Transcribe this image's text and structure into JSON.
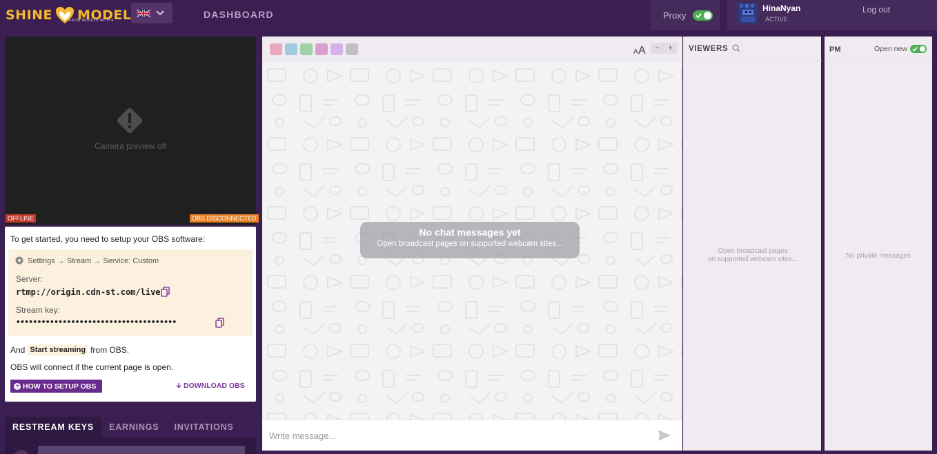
{
  "header": {
    "logo_left": "SHINE",
    "logo_right": "MODEL",
    "logo_tagline": "FROM MODELS WITH ♥",
    "language_icon": "uk-flag-icon",
    "dashboard_label": "DASHBOARD",
    "proxy": {
      "label": "Proxy",
      "enabled": true
    },
    "user": {
      "name": "HinaNyan",
      "status": "ACTIVE"
    },
    "logout_label": "Log out"
  },
  "camera": {
    "icon": "warning-icon",
    "message": "Camera preview off",
    "status_badge": "OFFLINE",
    "obs_badge": "OBS DISCONNECTED"
  },
  "setup": {
    "intro": "To get started, you need to setup your OBS software:",
    "settings_path": "Settings → Stream → Service: Custom",
    "server_label": "Server:",
    "server_value": "rtmp://origin.cdn-st.com/live",
    "stream_key_label": "Stream key:",
    "stream_key_value": "••••••••••••••••••••••••••••••••••••••",
    "and_text": "And",
    "start_streaming": "Start streaming",
    "from_obs": "from OBS.",
    "connect_note": "OBS will connect if the current page is open.",
    "howto_button": "HOW TO SETUP OBS",
    "download_link": "DOWNLOAD OBS"
  },
  "tabs": [
    {
      "label": "RESTREAM KEYS",
      "active": true
    },
    {
      "label": "EARNINGS",
      "active": false
    },
    {
      "label": "INVITATIONS",
      "active": false
    }
  ],
  "chat": {
    "empty_title": "No chat messages yet",
    "empty_subtitle": "Open broadcast pages on supported webcam sites...",
    "input_placeholder": "Write message...",
    "site_icons": [
      {
        "name": "site-1-icon",
        "color": "#e0567e"
      },
      {
        "name": "site-2-icon",
        "color": "#3fa7c9"
      },
      {
        "name": "site-3-icon",
        "color": "#43b34a"
      },
      {
        "name": "site-4-icon",
        "color": "#c53fa6"
      },
      {
        "name": "site-5-icon",
        "color": "#b36ae0"
      },
      {
        "name": "site-6-icon",
        "color": "#8a8a8a"
      }
    ],
    "zoom_minus": "−",
    "zoom_plus": "+"
  },
  "viewers": {
    "title": "VIEWERS",
    "empty_line1": "Open broadcast pages",
    "empty_line2": "on supported webcam sites..."
  },
  "pm": {
    "title": "PM",
    "open_new_label": "Open new",
    "open_new_enabled": true,
    "empty": "No private messages"
  },
  "colors": {
    "brand_purple": "#3c1f52",
    "accent_gold": "#f5b82e",
    "toggle_green": "#4caf50",
    "offline_red": "#c0392b",
    "obs_orange": "#e67e22",
    "button_purple": "#6a2c8c"
  }
}
